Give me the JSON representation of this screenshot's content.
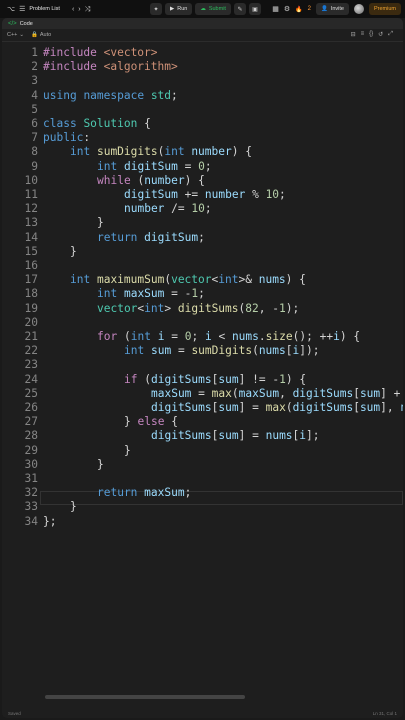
{
  "topbar": {
    "problem_list": "Problem List",
    "run": "Run",
    "submit": "Submit",
    "streak": "2",
    "invite": "Invite",
    "premium": "Premium"
  },
  "panel": {
    "title": "Code",
    "language": "C++",
    "autosave": "Auto"
  },
  "editor": {
    "lines": [
      "#include <vector>",
      "#include <algorithm>",
      "",
      "using namespace std;",
      "",
      "class Solution {",
      "public:",
      "    int sumDigits(int number) {",
      "        int digitSum = 0;",
      "        while (number) {",
      "            digitSum += number % 10;",
      "            number /= 10;",
      "        }",
      "        return digitSum;",
      "    }",
      "",
      "    int maximumSum(vector<int>& nums) {",
      "        int maxSum = -1;",
      "        vector<int> digitSums(82, -1);",
      "",
      "        for (int i = 0; i < nums.size(); ++i) {         //",
      "            int sum = sumDigits(nums[i]);",
      "",
      "            if (digitSums[sum] != -1) {",
      "                maxSum = max(maxSum, digitSums[sum] + num",
      "                digitSums[sum] = max(digitSums[sum], nums",
      "            } else {",
      "                digitSums[sum] = nums[i];",
      "            }",
      "        }",
      "",
      "        return maxSum;",
      "    }",
      "};"
    ],
    "line_numbers": [
      "1",
      "2",
      "3",
      "4",
      "5",
      "6",
      "7",
      "8",
      "9",
      "10",
      "11",
      "12",
      "13",
      "14",
      "15",
      "16",
      "17",
      "18",
      "19",
      "20",
      "21",
      "22",
      "23",
      "24",
      "25",
      "26",
      "27",
      "28",
      "29",
      "30",
      "31",
      "32",
      "33",
      "34"
    ]
  },
  "status": {
    "left": "Saved",
    "right": "Ln 31, Col 1"
  }
}
